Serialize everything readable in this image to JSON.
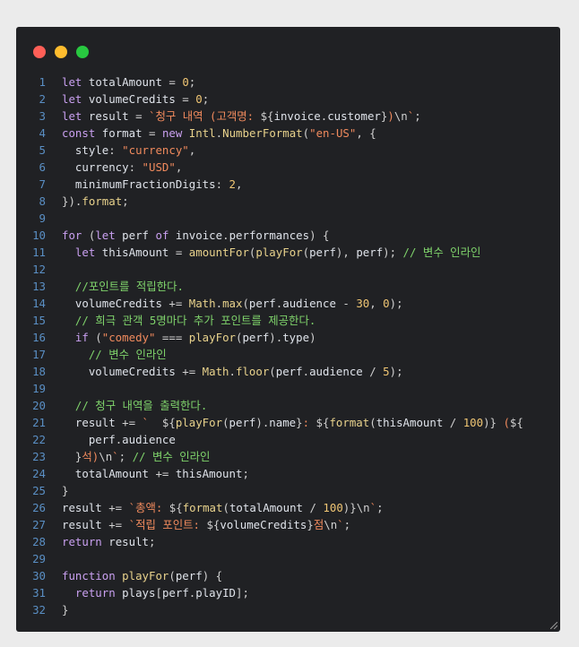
{
  "window": {
    "buttons": [
      "close",
      "minimize",
      "maximize"
    ]
  },
  "colors": {
    "background": "#202124",
    "keyword": "#c9a0f0",
    "string": "#f08a5d",
    "number": "#f0c674",
    "comment": "#7fd36b",
    "line_number": "#5a8fc4"
  },
  "code": {
    "lines": [
      {
        "n": "1",
        "tokens": [
          [
            "k",
            "let"
          ],
          [
            "p",
            " "
          ],
          [
            "v",
            "totalAmount"
          ],
          [
            "p",
            " = "
          ],
          [
            "n",
            "0"
          ],
          [
            "p",
            ";"
          ]
        ]
      },
      {
        "n": "2",
        "tokens": [
          [
            "k",
            "let"
          ],
          [
            "p",
            " "
          ],
          [
            "v",
            "volumeCredits"
          ],
          [
            "p",
            " = "
          ],
          [
            "n",
            "0"
          ],
          [
            "p",
            ";"
          ]
        ]
      },
      {
        "n": "3",
        "tokens": [
          [
            "k",
            "let"
          ],
          [
            "p",
            " "
          ],
          [
            "v",
            "result"
          ],
          [
            "p",
            " = "
          ],
          [
            "s",
            "`청구 내역 (고객명: "
          ],
          [
            "p",
            "${"
          ],
          [
            "v",
            "invoice"
          ],
          [
            "p",
            "."
          ],
          [
            "v",
            "customer"
          ],
          [
            "p",
            "}"
          ],
          [
            "s",
            ")"
          ],
          [
            "p",
            "\\n"
          ],
          [
            "s",
            "`"
          ],
          [
            "p",
            ";"
          ]
        ]
      },
      {
        "n": "4",
        "tokens": [
          [
            "k",
            "const"
          ],
          [
            "p",
            " "
          ],
          [
            "v",
            "format"
          ],
          [
            "p",
            " = "
          ],
          [
            "k",
            "new"
          ],
          [
            "p",
            " "
          ],
          [
            "f",
            "Intl"
          ],
          [
            "p",
            "."
          ],
          [
            "f",
            "NumberFormat"
          ],
          [
            "p",
            "("
          ],
          [
            "s",
            "\"en-US\""
          ],
          [
            "p",
            ", {"
          ]
        ]
      },
      {
        "n": "5",
        "tokens": [
          [
            "p",
            "  "
          ],
          [
            "v",
            "style"
          ],
          [
            "p",
            ": "
          ],
          [
            "s",
            "\"currency\""
          ],
          [
            "p",
            ","
          ]
        ]
      },
      {
        "n": "6",
        "tokens": [
          [
            "p",
            "  "
          ],
          [
            "v",
            "currency"
          ],
          [
            "p",
            ": "
          ],
          [
            "s",
            "\"USD\""
          ],
          [
            "p",
            ","
          ]
        ]
      },
      {
        "n": "7",
        "tokens": [
          [
            "p",
            "  "
          ],
          [
            "v",
            "minimumFractionDigits"
          ],
          [
            "p",
            ": "
          ],
          [
            "n",
            "2"
          ],
          [
            "p",
            ","
          ]
        ]
      },
      {
        "n": "8",
        "tokens": [
          [
            "p",
            "})."
          ],
          [
            "f",
            "format"
          ],
          [
            "p",
            ";"
          ]
        ]
      },
      {
        "n": "9",
        "tokens": []
      },
      {
        "n": "10",
        "tokens": [
          [
            "k",
            "for"
          ],
          [
            "p",
            " ("
          ],
          [
            "k",
            "let"
          ],
          [
            "p",
            " "
          ],
          [
            "v",
            "perf"
          ],
          [
            "p",
            " "
          ],
          [
            "k",
            "of"
          ],
          [
            "p",
            " "
          ],
          [
            "v",
            "invoice"
          ],
          [
            "p",
            "."
          ],
          [
            "v",
            "performances"
          ],
          [
            "p",
            ") {"
          ]
        ]
      },
      {
        "n": "11",
        "tokens": [
          [
            "p",
            "  "
          ],
          [
            "k",
            "let"
          ],
          [
            "p",
            " "
          ],
          [
            "v",
            "thisAmount"
          ],
          [
            "p",
            " = "
          ],
          [
            "f",
            "amountFor"
          ],
          [
            "p",
            "("
          ],
          [
            "f",
            "playFor"
          ],
          [
            "p",
            "("
          ],
          [
            "v",
            "perf"
          ],
          [
            "p",
            "), "
          ],
          [
            "v",
            "perf"
          ],
          [
            "p",
            "); "
          ],
          [
            "c",
            "// 변수 인라인"
          ]
        ]
      },
      {
        "n": "12",
        "tokens": []
      },
      {
        "n": "13",
        "tokens": [
          [
            "p",
            "  "
          ],
          [
            "c",
            "//포인트를 적립한다."
          ]
        ]
      },
      {
        "n": "14",
        "tokens": [
          [
            "p",
            "  "
          ],
          [
            "v",
            "volumeCredits"
          ],
          [
            "p",
            " += "
          ],
          [
            "f",
            "Math"
          ],
          [
            "p",
            "."
          ],
          [
            "f",
            "max"
          ],
          [
            "p",
            "("
          ],
          [
            "v",
            "perf"
          ],
          [
            "p",
            "."
          ],
          [
            "v",
            "audience"
          ],
          [
            "p",
            " - "
          ],
          [
            "n",
            "30"
          ],
          [
            "p",
            ", "
          ],
          [
            "n",
            "0"
          ],
          [
            "p",
            ");"
          ]
        ]
      },
      {
        "n": "15",
        "tokens": [
          [
            "p",
            "  "
          ],
          [
            "c",
            "// 희극 관객 5명마다 추가 포인트를 제공한다."
          ]
        ]
      },
      {
        "n": "16",
        "tokens": [
          [
            "p",
            "  "
          ],
          [
            "k",
            "if"
          ],
          [
            "p",
            " ("
          ],
          [
            "s",
            "\"comedy\""
          ],
          [
            "p",
            " === "
          ],
          [
            "f",
            "playFor"
          ],
          [
            "p",
            "("
          ],
          [
            "v",
            "perf"
          ],
          [
            "p",
            ")."
          ],
          [
            "v",
            "type"
          ],
          [
            "p",
            ")"
          ]
        ]
      },
      {
        "n": "17",
        "tokens": [
          [
            "p",
            "    "
          ],
          [
            "c",
            "// 변수 인라인"
          ]
        ]
      },
      {
        "n": "18",
        "tokens": [
          [
            "p",
            "    "
          ],
          [
            "v",
            "volumeCredits"
          ],
          [
            "p",
            " += "
          ],
          [
            "f",
            "Math"
          ],
          [
            "p",
            "."
          ],
          [
            "f",
            "floor"
          ],
          [
            "p",
            "("
          ],
          [
            "v",
            "perf"
          ],
          [
            "p",
            "."
          ],
          [
            "v",
            "audience"
          ],
          [
            "p",
            " / "
          ],
          [
            "n",
            "5"
          ],
          [
            "p",
            ");"
          ]
        ]
      },
      {
        "n": "19",
        "tokens": []
      },
      {
        "n": "20",
        "tokens": [
          [
            "p",
            "  "
          ],
          [
            "c",
            "// 청구 내역을 출력한다."
          ]
        ]
      },
      {
        "n": "21",
        "tokens": [
          [
            "p",
            "  "
          ],
          [
            "v",
            "result"
          ],
          [
            "p",
            " += "
          ],
          [
            "s",
            "`  "
          ],
          [
            "p",
            "${"
          ],
          [
            "f",
            "playFor"
          ],
          [
            "p",
            "("
          ],
          [
            "v",
            "perf"
          ],
          [
            "p",
            ")."
          ],
          [
            "v",
            "name"
          ],
          [
            "p",
            "}"
          ],
          [
            "s",
            ": "
          ],
          [
            "p",
            "${"
          ],
          [
            "f",
            "format"
          ],
          [
            "p",
            "("
          ],
          [
            "v",
            "thisAmount"
          ],
          [
            "p",
            " / "
          ],
          [
            "n",
            "100"
          ],
          [
            "p",
            ")}"
          ],
          [
            "s",
            " ("
          ],
          [
            "p",
            "${"
          ]
        ]
      },
      {
        "n": "22",
        "tokens": [
          [
            "p",
            "    "
          ],
          [
            "v",
            "perf"
          ],
          [
            "p",
            "."
          ],
          [
            "v",
            "audience"
          ]
        ]
      },
      {
        "n": "23",
        "tokens": [
          [
            "p",
            "  }"
          ],
          [
            "s",
            "석)"
          ],
          [
            "p",
            "\\n"
          ],
          [
            "s",
            "`"
          ],
          [
            "p",
            "; "
          ],
          [
            "c",
            "// 변수 인라인"
          ]
        ]
      },
      {
        "n": "24",
        "tokens": [
          [
            "p",
            "  "
          ],
          [
            "v",
            "totalAmount"
          ],
          [
            "p",
            " += "
          ],
          [
            "v",
            "thisAmount"
          ],
          [
            "p",
            ";"
          ]
        ]
      },
      {
        "n": "25",
        "tokens": [
          [
            "p",
            "}"
          ]
        ]
      },
      {
        "n": "26",
        "tokens": [
          [
            "v",
            "result"
          ],
          [
            "p",
            " += "
          ],
          [
            "s",
            "`총액: "
          ],
          [
            "p",
            "${"
          ],
          [
            "f",
            "format"
          ],
          [
            "p",
            "("
          ],
          [
            "v",
            "totalAmount"
          ],
          [
            "p",
            " / "
          ],
          [
            "n",
            "100"
          ],
          [
            "p",
            ")}"
          ],
          [
            "p",
            "\\n"
          ],
          [
            "s",
            "`"
          ],
          [
            "p",
            ";"
          ]
        ]
      },
      {
        "n": "27",
        "tokens": [
          [
            "v",
            "result"
          ],
          [
            "p",
            " += "
          ],
          [
            "s",
            "`적립 포인트: "
          ],
          [
            "p",
            "${"
          ],
          [
            "v",
            "volumeCredits"
          ],
          [
            "p",
            "}"
          ],
          [
            "s",
            "점"
          ],
          [
            "p",
            "\\n"
          ],
          [
            "s",
            "`"
          ],
          [
            "p",
            ";"
          ]
        ]
      },
      {
        "n": "28",
        "tokens": [
          [
            "k",
            "return"
          ],
          [
            "p",
            " "
          ],
          [
            "v",
            "result"
          ],
          [
            "p",
            ";"
          ]
        ]
      },
      {
        "n": "29",
        "tokens": []
      },
      {
        "n": "30",
        "tokens": [
          [
            "k",
            "function"
          ],
          [
            "p",
            " "
          ],
          [
            "f",
            "playFor"
          ],
          [
            "p",
            "("
          ],
          [
            "v",
            "perf"
          ],
          [
            "p",
            ") {"
          ]
        ]
      },
      {
        "n": "31",
        "tokens": [
          [
            "p",
            "  "
          ],
          [
            "k",
            "return"
          ],
          [
            "p",
            " "
          ],
          [
            "v",
            "plays"
          ],
          [
            "p",
            "["
          ],
          [
            "v",
            "perf"
          ],
          [
            "p",
            "."
          ],
          [
            "v",
            "playID"
          ],
          [
            "p",
            "];"
          ]
        ]
      },
      {
        "n": "32",
        "tokens": [
          [
            "p",
            "}"
          ]
        ]
      }
    ]
  }
}
